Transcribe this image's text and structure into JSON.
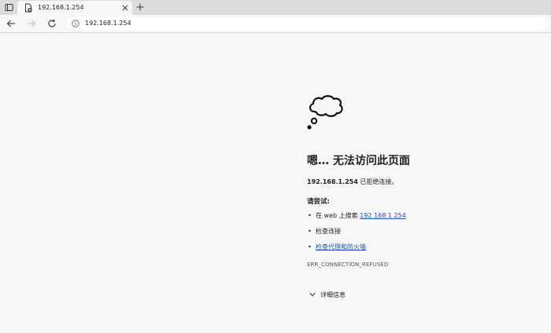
{
  "tab": {
    "title": "192.168.1.254"
  },
  "address_bar": {
    "url": "192.168.1.254"
  },
  "error_page": {
    "heading": "嗯… 无法访问此页面",
    "host": "192.168.1.254",
    "refused_text": " 已拒绝连接。",
    "try_label": "请尝试:",
    "suggestions": [
      {
        "prefix": "在 web 上搜索 ",
        "link": "192 168 1 254"
      },
      {
        "prefix": "检查连接",
        "link": ""
      },
      {
        "prefix": "",
        "link": "检查代理和防火墙"
      }
    ],
    "error_code": "ERR_CONNECTION_REFUSED",
    "details_label": "详细信息"
  },
  "icons": {
    "tab_actions": "tab-actions-icon",
    "favicon": "page-error-icon",
    "close": "close-icon",
    "new_tab": "plus-icon",
    "back": "back-arrow-icon",
    "forward": "forward-arrow-icon",
    "refresh": "refresh-icon",
    "site_info": "info-icon",
    "cloud": "thought-cloud-icon",
    "details": "chevron-down-icon"
  },
  "colors": {
    "link": "#1a56b8",
    "background": "#f7f7f7",
    "tabbar": "#dcdcdc"
  }
}
